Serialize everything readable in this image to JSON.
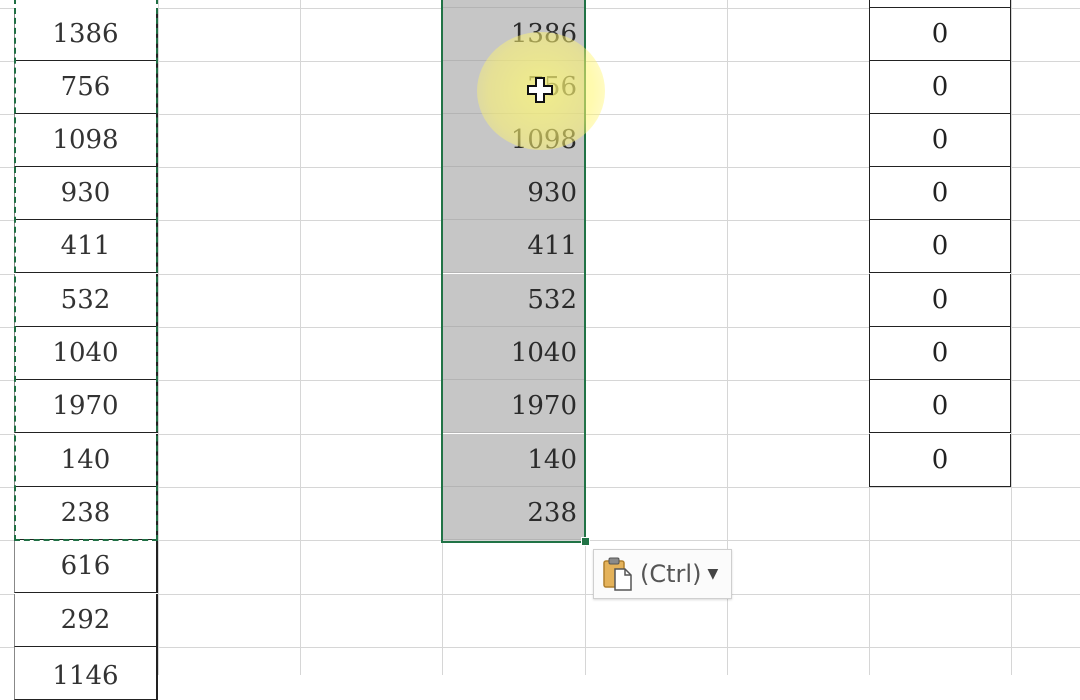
{
  "sheet": {
    "colA_values": [
      "1386",
      "756",
      "1098",
      "930",
      "411",
      "532",
      "1040",
      "1970",
      "140",
      "238",
      "616",
      "292",
      "1146"
    ],
    "selected_values": [
      "1386",
      "756",
      "1098",
      "930",
      "411",
      "532",
      "1040",
      "1970",
      "140",
      "238"
    ],
    "colF_values": [
      "0",
      "0",
      "0",
      "0",
      "0",
      "0",
      "0",
      "0",
      "0"
    ]
  },
  "paste_options": {
    "label": "(Ctrl)",
    "icon": "clipboard-paste-icon",
    "caret_icon": "dropdown-caret-icon"
  },
  "colors": {
    "selection_border": "#217346",
    "selection_fill": "#c6c6c6",
    "highlight": "#fff56e",
    "gridline": "#d6d6d6"
  }
}
